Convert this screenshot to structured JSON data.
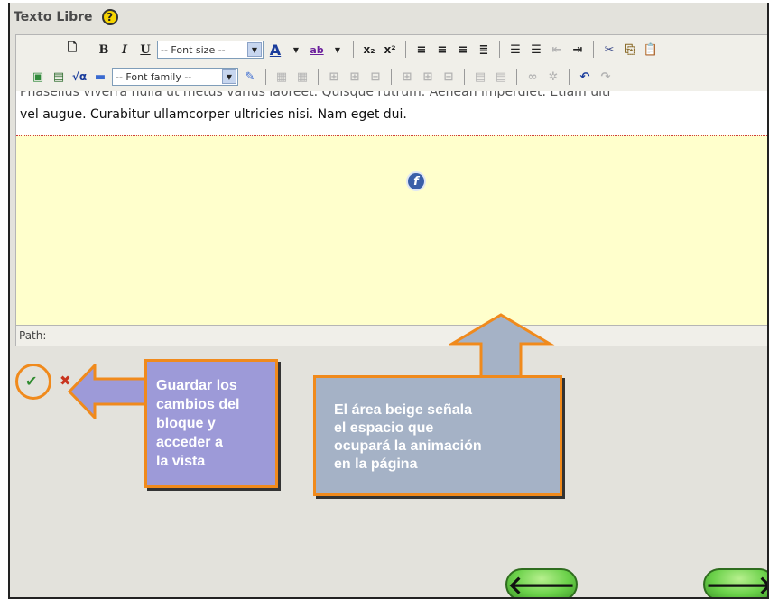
{
  "block": {
    "title": "Texto Libre",
    "help_icon": "?"
  },
  "toolbar1": {
    "new_icon": "🗋",
    "bold": "B",
    "italic": "I",
    "underline": "U",
    "font_size": "-- Font size --",
    "font_color": "A",
    "highlight": "ab",
    "subscript": "x₂",
    "superscript": "x²"
  },
  "toolbar2": {
    "font_family": "-- Font family --"
  },
  "content": {
    "partial_line": "Phasellus viverra nulla ut metus varius laoreet. Quisque rutrum. Aenean imperdiet. Etiam ultr",
    "line": "vel augue. Curabitur ullamcorper ultricies nisi. Nam eget dui."
  },
  "path_bar": {
    "label": "Path:"
  },
  "callouts": {
    "save": [
      "Guardar los",
      "cambios del",
      "bloque y",
      "acceder a",
      "la vista"
    ],
    "flash": [
      "El área beige señala",
      "el espacio que",
      "ocupará la animación",
      "en la página"
    ]
  },
  "icons": {
    "save": "✔",
    "cancel": "✖",
    "flash": "f",
    "prev": "🡐",
    "next": "🡒"
  },
  "colors": {
    "callout_border": "#f08a1c",
    "flash_area": "#ffffcc",
    "save_callout": "#9d9ad8",
    "flash_callout": "#a5b2c6",
    "nav_green": "#6bd14a"
  }
}
